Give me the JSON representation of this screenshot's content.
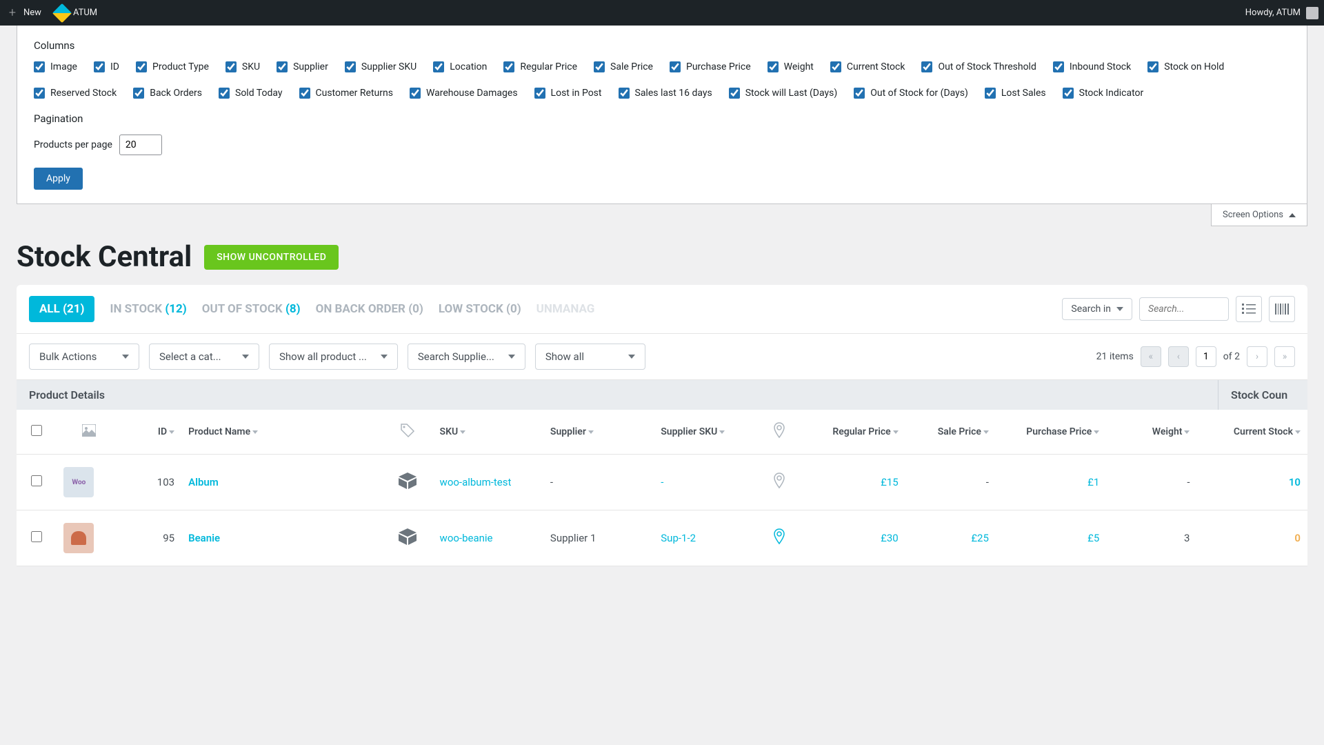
{
  "adminbar": {
    "new": "New",
    "atum": "ATUM",
    "howdy": "Howdy, ATUM"
  },
  "screenOptions": {
    "columnsHeading": "Columns",
    "columns": [
      "Image",
      "ID",
      "Product Type",
      "SKU",
      "Supplier",
      "Supplier SKU",
      "Location",
      "Regular Price",
      "Sale Price",
      "Purchase Price",
      "Weight",
      "Current Stock",
      "Out of Stock Threshold",
      "Inbound Stock",
      "Stock on Hold",
      "Reserved Stock",
      "Back Orders",
      "Sold Today",
      "Customer Returns",
      "Warehouse Damages",
      "Lost in Post",
      "Sales last 16 days",
      "Stock will Last (Days)",
      "Out of Stock for (Days)",
      "Lost Sales",
      "Stock Indicator"
    ],
    "paginationHeading": "Pagination",
    "perPageLabel": "Products per page",
    "perPageValue": "20",
    "applyLabel": "Apply",
    "tabLabel": "Screen Options"
  },
  "page": {
    "title": "Stock Central",
    "showUncontrolled": "SHOW UNCONTROLLED"
  },
  "filterTabs": {
    "all": {
      "label": "ALL",
      "count": "(21)"
    },
    "inStock": {
      "label": "IN STOCK",
      "count": "(12)"
    },
    "outStock": {
      "label": "OUT OF STOCK",
      "count": "(8)"
    },
    "backOrder": {
      "label": "ON BACK ORDER",
      "count": "(0)"
    },
    "lowStock": {
      "label": "LOW STOCK",
      "count": "(0)"
    },
    "unmanaged": {
      "label": "UNMANAG"
    }
  },
  "search": {
    "searchIn": "Search in",
    "placeholder": "Search..."
  },
  "bulk": {
    "bulkActions": "Bulk Actions",
    "selectCat": "Select a cat...",
    "showProducts": "Show all product ...",
    "searchSupplier": "Search Supplie...",
    "showAll": "Show all"
  },
  "pagination": {
    "items": "21 items",
    "current": "1",
    "of": "of 2"
  },
  "sections": {
    "productDetails": "Product Details",
    "stockCount": "Stock Coun"
  },
  "headers": {
    "id": "ID",
    "productName": "Product Name",
    "sku": "SKU",
    "supplier": "Supplier",
    "supplierSku": "Supplier SKU",
    "regularPrice": "Regular Price",
    "salePrice": "Sale Price",
    "purchasePrice": "Purchase Price",
    "weight": "Weight",
    "currentStock": "Current Stock"
  },
  "rows": [
    {
      "id": "103",
      "name": "Album",
      "sku": "woo-album-test",
      "supplier": "-",
      "supplierSku": "-",
      "regularPrice": "£15",
      "salePrice": "-",
      "purchasePrice": "£1",
      "weight": "-",
      "currentStock": "10",
      "stockColor": "#00b8db",
      "pinActive": false,
      "thumbType": "album"
    },
    {
      "id": "95",
      "name": "Beanie",
      "sku": "woo-beanie",
      "supplier": "Supplier 1",
      "supplierSku": "Sup-1-2",
      "regularPrice": "£30",
      "salePrice": "£25",
      "purchasePrice": "£5",
      "weight": "3",
      "currentStock": "0",
      "stockColor": "#f0ad4e",
      "pinActive": true,
      "thumbType": "beanie"
    }
  ]
}
